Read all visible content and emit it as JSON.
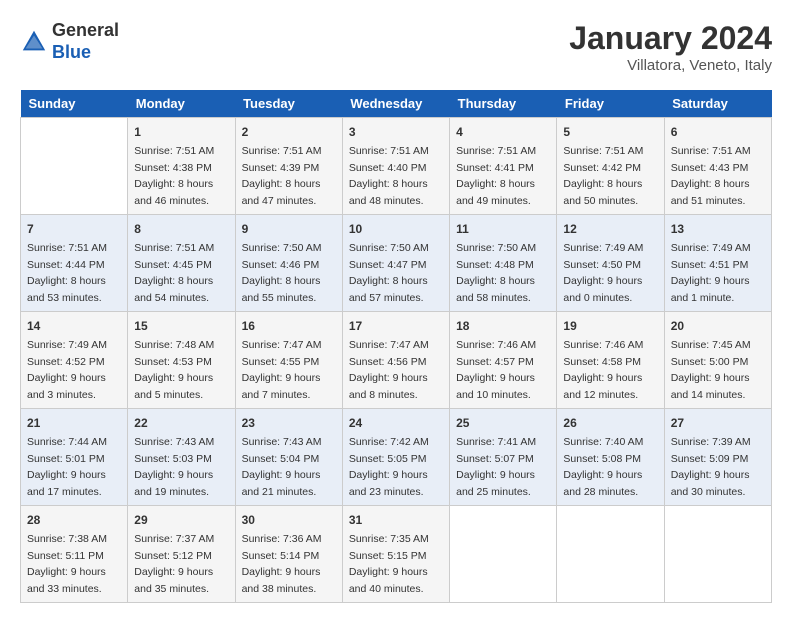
{
  "header": {
    "logo_general": "General",
    "logo_blue": "Blue",
    "month_title": "January 2024",
    "location": "Villatora, Veneto, Italy"
  },
  "days_of_week": [
    "Sunday",
    "Monday",
    "Tuesday",
    "Wednesday",
    "Thursday",
    "Friday",
    "Saturday"
  ],
  "weeks": [
    [
      {
        "day": "",
        "info": ""
      },
      {
        "day": "1",
        "info": "Sunrise: 7:51 AM\nSunset: 4:38 PM\nDaylight: 8 hours\nand 46 minutes."
      },
      {
        "day": "2",
        "info": "Sunrise: 7:51 AM\nSunset: 4:39 PM\nDaylight: 8 hours\nand 47 minutes."
      },
      {
        "day": "3",
        "info": "Sunrise: 7:51 AM\nSunset: 4:40 PM\nDaylight: 8 hours\nand 48 minutes."
      },
      {
        "day": "4",
        "info": "Sunrise: 7:51 AM\nSunset: 4:41 PM\nDaylight: 8 hours\nand 49 minutes."
      },
      {
        "day": "5",
        "info": "Sunrise: 7:51 AM\nSunset: 4:42 PM\nDaylight: 8 hours\nand 50 minutes."
      },
      {
        "day": "6",
        "info": "Sunrise: 7:51 AM\nSunset: 4:43 PM\nDaylight: 8 hours\nand 51 minutes."
      }
    ],
    [
      {
        "day": "7",
        "info": "Sunrise: 7:51 AM\nSunset: 4:44 PM\nDaylight: 8 hours\nand 53 minutes."
      },
      {
        "day": "8",
        "info": "Sunrise: 7:51 AM\nSunset: 4:45 PM\nDaylight: 8 hours\nand 54 minutes."
      },
      {
        "day": "9",
        "info": "Sunrise: 7:50 AM\nSunset: 4:46 PM\nDaylight: 8 hours\nand 55 minutes."
      },
      {
        "day": "10",
        "info": "Sunrise: 7:50 AM\nSunset: 4:47 PM\nDaylight: 8 hours\nand 57 minutes."
      },
      {
        "day": "11",
        "info": "Sunrise: 7:50 AM\nSunset: 4:48 PM\nDaylight: 8 hours\nand 58 minutes."
      },
      {
        "day": "12",
        "info": "Sunrise: 7:49 AM\nSunset: 4:50 PM\nDaylight: 9 hours\nand 0 minutes."
      },
      {
        "day": "13",
        "info": "Sunrise: 7:49 AM\nSunset: 4:51 PM\nDaylight: 9 hours\nand 1 minute."
      }
    ],
    [
      {
        "day": "14",
        "info": "Sunrise: 7:49 AM\nSunset: 4:52 PM\nDaylight: 9 hours\nand 3 minutes."
      },
      {
        "day": "15",
        "info": "Sunrise: 7:48 AM\nSunset: 4:53 PM\nDaylight: 9 hours\nand 5 minutes."
      },
      {
        "day": "16",
        "info": "Sunrise: 7:47 AM\nSunset: 4:55 PM\nDaylight: 9 hours\nand 7 minutes."
      },
      {
        "day": "17",
        "info": "Sunrise: 7:47 AM\nSunset: 4:56 PM\nDaylight: 9 hours\nand 8 minutes."
      },
      {
        "day": "18",
        "info": "Sunrise: 7:46 AM\nSunset: 4:57 PM\nDaylight: 9 hours\nand 10 minutes."
      },
      {
        "day": "19",
        "info": "Sunrise: 7:46 AM\nSunset: 4:58 PM\nDaylight: 9 hours\nand 12 minutes."
      },
      {
        "day": "20",
        "info": "Sunrise: 7:45 AM\nSunset: 5:00 PM\nDaylight: 9 hours\nand 14 minutes."
      }
    ],
    [
      {
        "day": "21",
        "info": "Sunrise: 7:44 AM\nSunset: 5:01 PM\nDaylight: 9 hours\nand 17 minutes."
      },
      {
        "day": "22",
        "info": "Sunrise: 7:43 AM\nSunset: 5:03 PM\nDaylight: 9 hours\nand 19 minutes."
      },
      {
        "day": "23",
        "info": "Sunrise: 7:43 AM\nSunset: 5:04 PM\nDaylight: 9 hours\nand 21 minutes."
      },
      {
        "day": "24",
        "info": "Sunrise: 7:42 AM\nSunset: 5:05 PM\nDaylight: 9 hours\nand 23 minutes."
      },
      {
        "day": "25",
        "info": "Sunrise: 7:41 AM\nSunset: 5:07 PM\nDaylight: 9 hours\nand 25 minutes."
      },
      {
        "day": "26",
        "info": "Sunrise: 7:40 AM\nSunset: 5:08 PM\nDaylight: 9 hours\nand 28 minutes."
      },
      {
        "day": "27",
        "info": "Sunrise: 7:39 AM\nSunset: 5:09 PM\nDaylight: 9 hours\nand 30 minutes."
      }
    ],
    [
      {
        "day": "28",
        "info": "Sunrise: 7:38 AM\nSunset: 5:11 PM\nDaylight: 9 hours\nand 33 minutes."
      },
      {
        "day": "29",
        "info": "Sunrise: 7:37 AM\nSunset: 5:12 PM\nDaylight: 9 hours\nand 35 minutes."
      },
      {
        "day": "30",
        "info": "Sunrise: 7:36 AM\nSunset: 5:14 PM\nDaylight: 9 hours\nand 38 minutes."
      },
      {
        "day": "31",
        "info": "Sunrise: 7:35 AM\nSunset: 5:15 PM\nDaylight: 9 hours\nand 40 minutes."
      },
      {
        "day": "",
        "info": ""
      },
      {
        "day": "",
        "info": ""
      },
      {
        "day": "",
        "info": ""
      }
    ]
  ]
}
